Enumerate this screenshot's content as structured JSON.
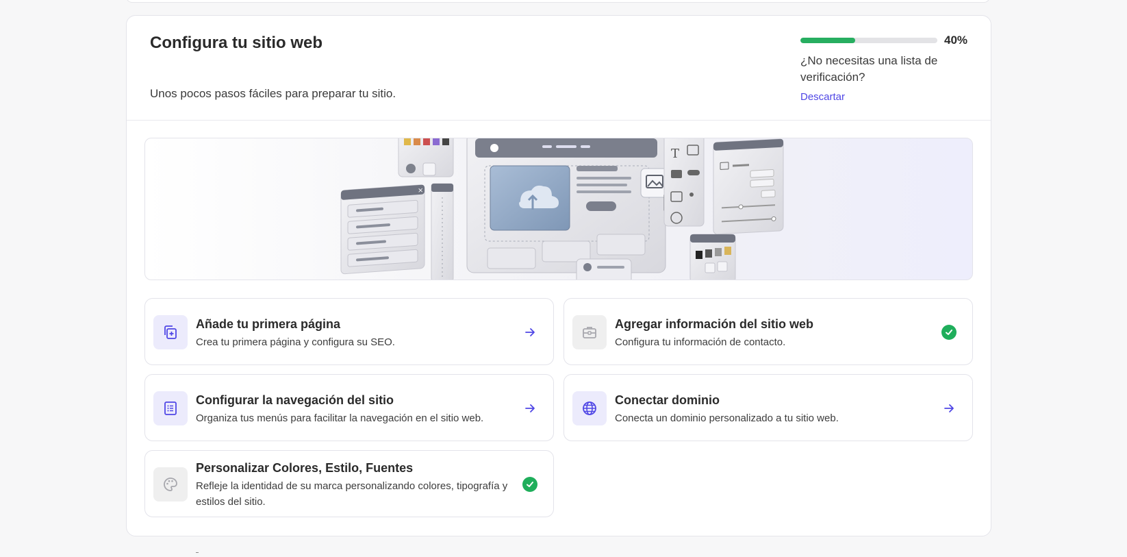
{
  "header": {
    "title": "Configura tu sitio web",
    "subtitle": "Unos pocos pasos fáciles para preparar tu sitio."
  },
  "progress": {
    "percent_label": "40%",
    "value": 0.4,
    "question": "¿No necesitas una lista de verificación?",
    "dismiss_label": "Descartar"
  },
  "banner": {
    "icon": "website-builder-illustration"
  },
  "tasks": [
    {
      "title": "Añade tu primera página",
      "description": "Crea tu primera página y configura su SEO.",
      "icon": "add-page-icon",
      "status": "pending"
    },
    {
      "title": "Agregar información del sitio web",
      "description": "Configura tu información de contacto.",
      "icon": "briefcase-icon",
      "status": "done"
    },
    {
      "title": "Configurar la navegación del sitio",
      "description": "Organiza tus menús para facilitar la navegación en el sitio web.",
      "icon": "list-icon",
      "status": "pending"
    },
    {
      "title": "Conectar dominio",
      "description": "Conecta un dominio personalizado a tu sitio web.",
      "icon": "globe-icon",
      "status": "pending"
    },
    {
      "title": "Personalizar Colores, Estilo, Fuentes",
      "description": "Refleje la identidad de su marca personalizando colores, tipografía y estilos del sitio.",
      "icon": "palette-icon",
      "status": "done"
    }
  ],
  "colors": {
    "accent": "#4f46e5",
    "success": "#1fae5b",
    "progress": "#27ae60"
  }
}
